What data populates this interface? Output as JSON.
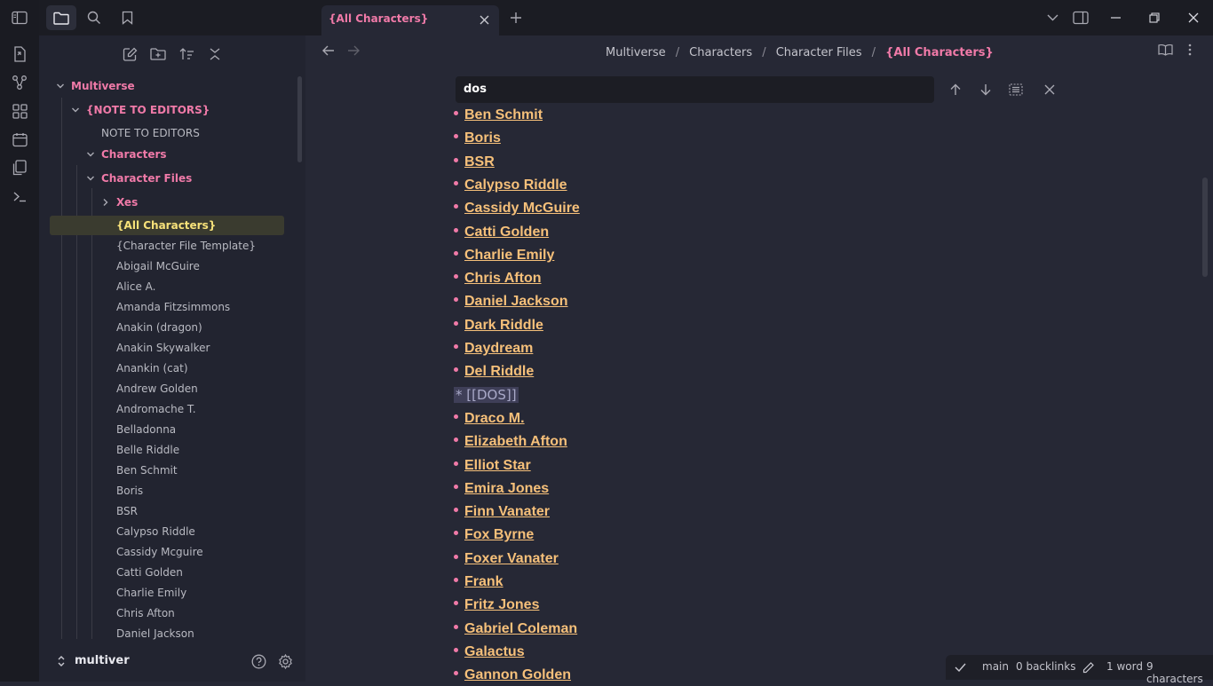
{
  "tab": {
    "title": "{All Characters}"
  },
  "breadcrumb": {
    "items": [
      "Multiverse",
      "Characters",
      "Character Files"
    ],
    "current": "{All Characters}",
    "separator": "/"
  },
  "search": {
    "value": "dos"
  },
  "sidebar": {
    "vault_name": "multiver",
    "tree": [
      {
        "label": "Multiverse",
        "type": "folder"
      },
      {
        "label": "{NOTE TO EDITORS}",
        "type": "folder"
      },
      {
        "label": "NOTE TO EDITORS",
        "type": "file"
      },
      {
        "label": "Characters",
        "type": "folder"
      },
      {
        "label": "Character Files",
        "type": "folder"
      },
      {
        "label": "Xes",
        "type": "folder-collapsed"
      },
      {
        "label": "{All Characters}",
        "type": "active-file"
      },
      {
        "label": "{Character File Template}",
        "type": "file"
      },
      {
        "label": "Abigail McGuire",
        "type": "file"
      },
      {
        "label": "Alice A.",
        "type": "file"
      },
      {
        "label": "Amanda Fitzsimmons",
        "type": "file"
      },
      {
        "label": "Anakin (dragon)",
        "type": "file"
      },
      {
        "label": "Anakin Skywalker",
        "type": "file"
      },
      {
        "label": "Anankin (cat)",
        "type": "file"
      },
      {
        "label": "Andrew Golden",
        "type": "file"
      },
      {
        "label": "Andromache T.",
        "type": "file"
      },
      {
        "label": "Belladonna",
        "type": "file"
      },
      {
        "label": "Belle Riddle",
        "type": "file"
      },
      {
        "label": "Ben Schmit",
        "type": "file"
      },
      {
        "label": "Boris",
        "type": "file"
      },
      {
        "label": "BSR",
        "type": "file"
      },
      {
        "label": "Calypso Riddle",
        "type": "file"
      },
      {
        "label": "Cassidy Mcguire",
        "type": "file"
      },
      {
        "label": "Catti Golden",
        "type": "file"
      },
      {
        "label": "Charlie Emily",
        "type": "file"
      },
      {
        "label": "Chris Afton",
        "type": "file"
      },
      {
        "label": "Daniel Jackson",
        "type": "file"
      }
    ]
  },
  "editor": {
    "items": [
      "Ben Schmit",
      "Boris",
      "BSR",
      "Calypso Riddle",
      "Cassidy McGuire",
      "Catti Golden",
      "Charlie Emily",
      "Chris Afton",
      "Daniel Jackson",
      "Dark Riddle",
      "Daydream",
      "Del Riddle",
      "* [[DOS]]",
      "Draco M.",
      "Elizabeth Afton",
      "Elliot Star",
      "Emira Jones",
      "Finn Vanater",
      "Fox Byrne",
      "Foxer Vanater",
      "Frank",
      "Fritz Jones",
      "Gabriel Coleman",
      "Galactus",
      "Gannon Golden"
    ]
  },
  "status": {
    "branch": "main",
    "backlinks": "0 backlinks",
    "words": "1 word",
    "characters": "9 characters"
  },
  "colors": {
    "accent": "#f07aa8",
    "link": "#f6c07a",
    "active": "#f7e27a",
    "background": "#262835"
  }
}
